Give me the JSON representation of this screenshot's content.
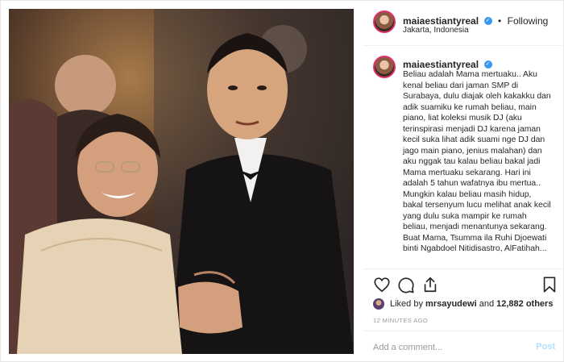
{
  "post": {
    "username": "maiaestiantyreal",
    "verified": true,
    "follow_status": "Following",
    "location": "Jakarta, Indonesia",
    "caption": "Beliau adalah Mama mertuaku.. Aku kenal beliau dari jaman SMP di Surabaya, dulu diajak oleh kakakku dan adik suamiku ke rumah beliau, main piano, liat koleksi musik DJ (aku terinspirasi menjadi DJ karena jaman kecil suka lihat adik suami nge DJ dan jago main piano, jenius malahan) dan aku nggak tau kalau beliau bakal jadi Mama mertuaku sekarang. Hari ini adalah 5 tahun wafatnya ibu mertua.. Mungkin kalau beliau masih hidup, bakal tersenyum lucu melihat anak kecil yang dulu suka mampir ke rumah beliau, menjadi menantunya sekarang. Buat Mama, Tsumma ila Ruhi Djoewati binti Ngabdoel Nitidisastro, AlFatihah...",
    "likes": {
      "prefix": "Liked by",
      "user": "mrsayudewi",
      "joiner": "and",
      "count": "12,882 others"
    },
    "timestamp": "12 MINUTES AGO",
    "comment_placeholder": "Add a comment...",
    "post_button": "Post"
  },
  "icons": {
    "like": "heart-icon",
    "comment": "comment-icon",
    "share": "share-icon",
    "save": "bookmark-icon",
    "verified": "verified-badge-icon"
  },
  "colors": {
    "verified": "#3897f0",
    "story_ring": "#e1306c",
    "post_disabled": "#b2dffc",
    "muted": "#999999"
  }
}
